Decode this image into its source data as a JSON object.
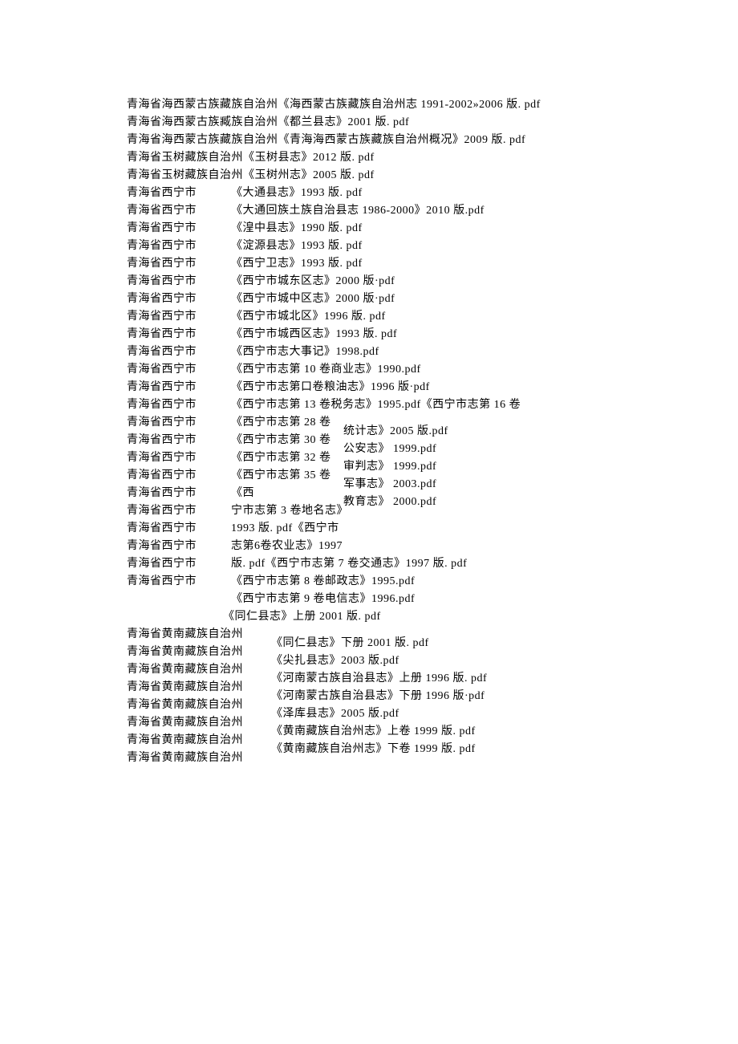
{
  "top_lines": [
    "青海省海西蒙古族藏族自治州《海西蒙古族藏族自治州志 1991-2002»2006 版. pdf",
    "青海省海西蒙古族臧族自治州《都兰县志》2001 版. pdf",
    "青海省海西蒙古族藏族自治州《青海海西蒙古族藏族自治州概况》2009 版. pdf",
    "青海省玉树藏族自治州《玉树县志》2012 版. pdf",
    "青海省玉树藏族自治州《玉树州志》2005 版. pdf"
  ],
  "xining_label": "青海省西宁市",
  "xining_last_label": "青海省西宁市",
  "xining_right": [
    "《大通县志》1993 版. pdf",
    "《大通回族土族自治县志 1986-2000》2010 版.pdf",
    "《湟中县志》1990 版. pdf",
    "《淀源县志》1993 版. pdf",
    "《西宁卫志》1993 版. pdf",
    "《西宁市城东区志》2000 版·pdf",
    "《西宁市城中区志》2000 版·pdf",
    "《西宁市城北区》1996 版. pdf",
    "《西宁市城西区志》1993 版. pdf",
    "《西宁市志大事记》1998.pdf",
    "《西宁市志第 10 卷商业志》1990.pdf",
    "《西宁市志第口卷粮油志》1996 版·pdf",
    "《西宁市志第 13 卷税务志》1995.pdf《西宁市志第 16 卷"
  ],
  "mid_a": [
    "《西宁市志第 28 卷",
    "《西宁市志第 30 卷",
    "《西宁市志第 32 卷",
    "《西宁市志第 35 卷《西",
    "宁市志第 3 卷地名志》",
    "1993 版. pdf《西宁市",
    "志第6卷农业志》1997"
  ],
  "mid_b": [
    "统计志》2005 版.pdf",
    "公安志》 1999.pdf",
    "审判志》 1999.pdf",
    "军事志》 2003.pdf",
    "教育志》 2000.pdf"
  ],
  "xining_tail": [
    "版. pdf《西宁市志第 7 卷交通志》1997 版. pdf",
    "《西宁市志第 8 卷邮政志》1995.pdf",
    "《西宁市志第 9 卷电信志》1996.pdf"
  ],
  "tongren_line": "《同仁县志》上册 2001 版. pdf",
  "huangnan_label": "青海省黄南藏族自治州",
  "huangnan_right": [
    "《同仁县志》下册 2001 版. pdf",
    "《尖扎县志》2003 版.pdf",
    "《河南蒙古族自治县志》上册 1996 版. pdf",
    "《河南蒙古族自治县志》下册 1996 版·pdf",
    "《泽库县志》2005 版.pdf",
    "《黄南藏族自治州志》上卷 1999 版. pdf",
    "《黄南藏族自治州志》下卷 1999 版. pdf"
  ]
}
